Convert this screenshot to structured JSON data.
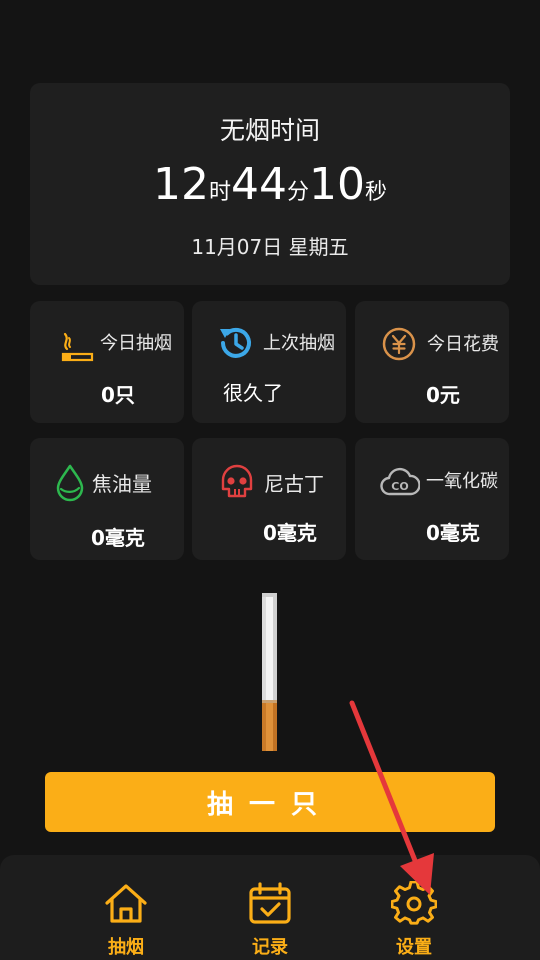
{
  "timer": {
    "title": "无烟时间",
    "hours": "12",
    "hours_unit": "时",
    "minutes": "44",
    "minutes_unit": "分",
    "seconds": "10",
    "seconds_unit": "秒",
    "date": "11月07日 星期五"
  },
  "stats": [
    {
      "label": "今日抽烟",
      "value": "0只",
      "icon": "cigarette-icon",
      "color": "#FBAE17"
    },
    {
      "label": "上次抽烟",
      "value": "很久了",
      "icon": "history-icon",
      "color": "#3CA8E8"
    },
    {
      "label": "今日花费",
      "value": "0元",
      "icon": "yuan-coin-icon",
      "color": "#D9924A"
    },
    {
      "label": "焦油量",
      "value": "0毫克",
      "icon": "droplet-icon",
      "color": "#2DB84E"
    },
    {
      "label": "尼古丁",
      "value": "0毫克",
      "icon": "skull-icon",
      "color": "#E04040"
    },
    {
      "label": "一氧化碳",
      "value": "0毫克",
      "icon": "co-cloud-icon",
      "color": "#B8B8B8"
    }
  ],
  "action": {
    "smoke_label": "抽一只"
  },
  "nav": {
    "items": [
      {
        "label": "抽烟",
        "icon": "home-icon"
      },
      {
        "label": "记录",
        "icon": "calendar-check-icon"
      },
      {
        "label": "设置",
        "icon": "gear-icon"
      }
    ]
  },
  "colors": {
    "accent": "#FBAE17",
    "background": "#141414",
    "card": "#1f1f1f",
    "annotation_arrow": "#E5383B"
  }
}
